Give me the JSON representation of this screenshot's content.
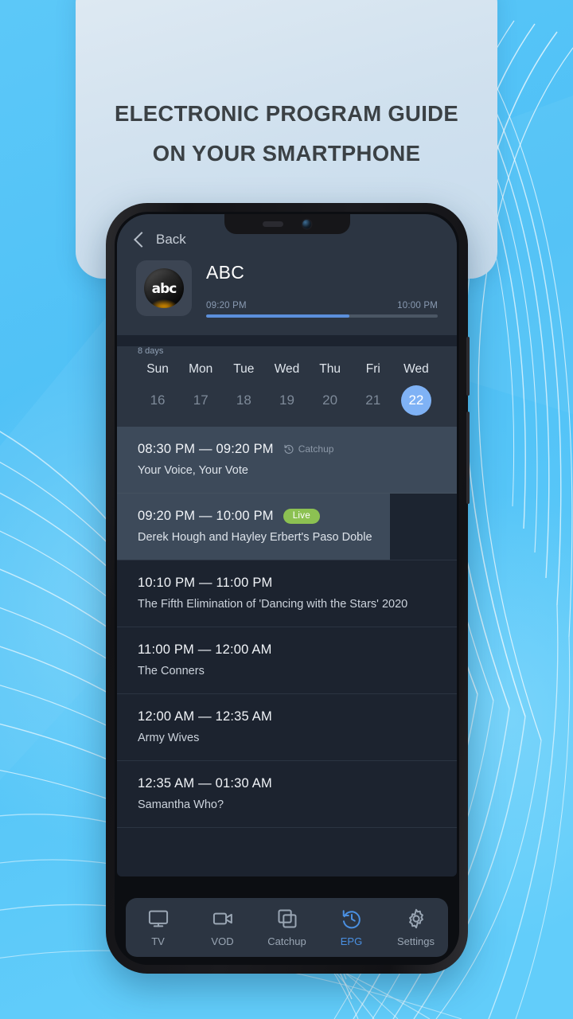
{
  "promo": {
    "line1": "ELECTRONIC PROGRAM GUIDE",
    "line2": "ON YOUR SMARTPHONE"
  },
  "app": {
    "back_label": "Back",
    "channel": {
      "name": "ABC",
      "logo_text": "abc"
    },
    "now_playing": {
      "start": "09:20 PM",
      "end": "10:00 PM",
      "progress_percent": 62
    },
    "days_label": "8 days",
    "days": [
      {
        "dow": "Sun",
        "date": "16",
        "selected": false
      },
      {
        "dow": "Mon",
        "date": "17",
        "selected": false
      },
      {
        "dow": "Tue",
        "date": "18",
        "selected": false
      },
      {
        "dow": "Wed",
        "date": "19",
        "selected": false
      },
      {
        "dow": "Thu",
        "date": "20",
        "selected": false
      },
      {
        "dow": "Fri",
        "date": "21",
        "selected": false
      },
      {
        "dow": "Wed",
        "date": "22",
        "selected": true
      }
    ],
    "programs": [
      {
        "time": "08:30 PM — 09:20 PM",
        "title": "Your Voice, Your Vote",
        "badge": "Catchup",
        "badge_type": "catchup",
        "state": "past"
      },
      {
        "time": "09:20 PM — 10:00 PM",
        "title": "Derek Hough and Hayley Erbert's Paso Doble",
        "badge": "Live",
        "badge_type": "live",
        "state": "live"
      },
      {
        "time": "10:10 PM — 11:00 PM",
        "title": "The Fifth Elimination of 'Dancing with the Stars' 2020",
        "badge": "",
        "badge_type": "",
        "state": "upcoming"
      },
      {
        "time": "11:00 PM — 12:00 AM",
        "title": "The Conners",
        "badge": "",
        "badge_type": "",
        "state": "upcoming"
      },
      {
        "time": "12:00 AM — 12:35 AM",
        "title": "Army Wives",
        "badge": "",
        "badge_type": "",
        "state": "upcoming"
      },
      {
        "time": "12:35 AM — 01:30 AM",
        "title": "Samantha Who?",
        "badge": "",
        "badge_type": "",
        "state": "upcoming"
      }
    ],
    "nav": [
      {
        "label": "TV",
        "icon": "tv-icon",
        "active": false
      },
      {
        "label": "VOD",
        "icon": "video-camera-icon",
        "active": false
      },
      {
        "label": "Catchup",
        "icon": "copy-layers-icon",
        "active": false
      },
      {
        "label": "EPG",
        "icon": "history-clock-icon",
        "active": true
      },
      {
        "label": "Settings",
        "icon": "gear-icon",
        "active": false
      }
    ]
  },
  "colors": {
    "background": "#4fc3f7",
    "accent_blue": "#4a90e2",
    "selected_day": "#7fb2f5",
    "live_green": "#8cc152",
    "progress_blue": "#5b8fdb",
    "header_panel": "#2c3542",
    "list_bg": "#1c232f"
  }
}
